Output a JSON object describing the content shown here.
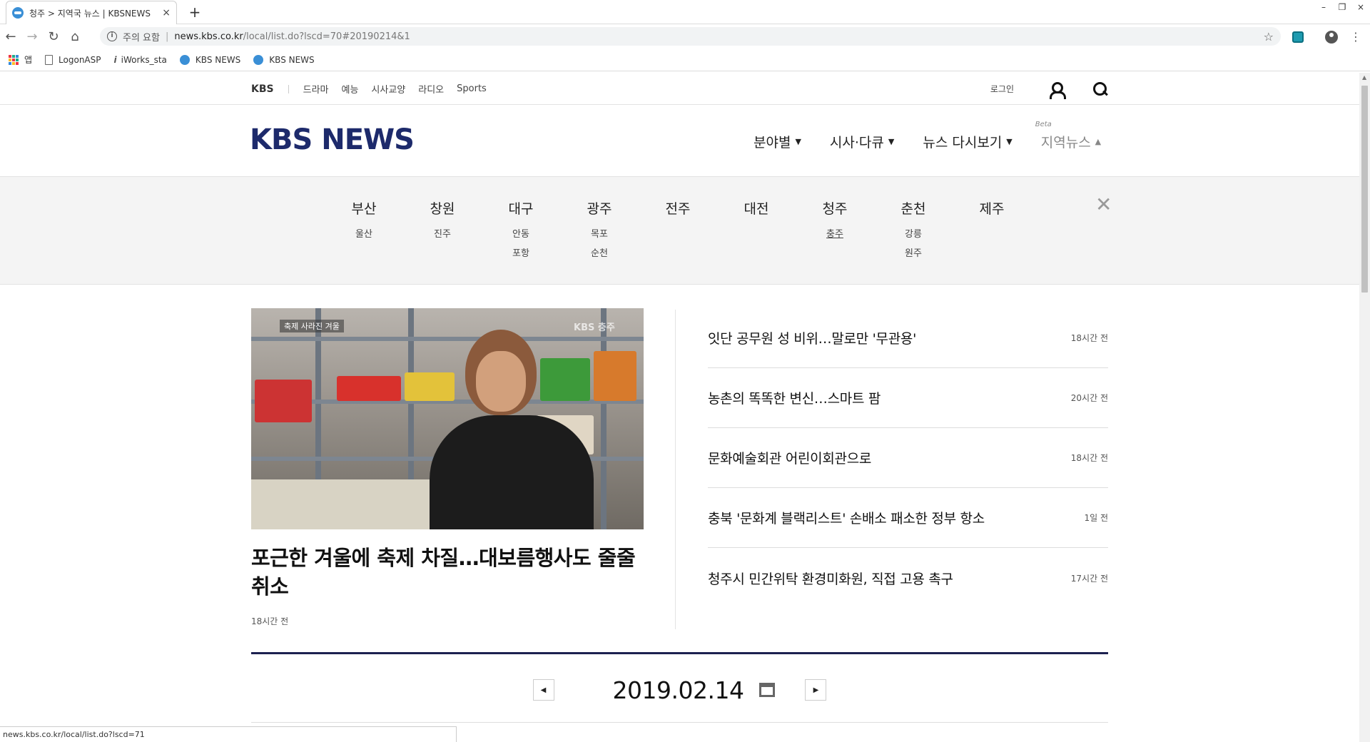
{
  "browser": {
    "tab_title": "청주 > 지역국 뉴스 | KBSNEWS",
    "tab_close": "×",
    "new_tab": "+",
    "window_controls": [
      "–",
      "❐",
      "×"
    ],
    "nav": {
      "back": "←",
      "forward": "→",
      "reload": "↻",
      "home": "⌂"
    },
    "address": {
      "security_label": "주의 요함",
      "url_host": "news.kbs.co.kr",
      "url_path": "/local/list.do?lscd=70#20190214&1"
    },
    "bookmarks": [
      {
        "label": "앱",
        "icon": "apps-icon"
      },
      {
        "label": "LogonASP",
        "icon": "page-icon"
      },
      {
        "label": "iWorks_sta",
        "icon": "iworks-icon"
      },
      {
        "label": "KBS NEWS",
        "icon": "kbs-icon"
      },
      {
        "label": "KBS NEWS",
        "icon": "kbs-icon"
      }
    ],
    "status_url": "news.kbs.co.kr/local/list.do?lscd=71"
  },
  "gnb": {
    "brand": "KBS",
    "links": [
      "드라마",
      "예능",
      "시사교양",
      "라디오",
      "Sports"
    ],
    "login": "로그인"
  },
  "header": {
    "logo": "KBS NEWS",
    "menu": [
      {
        "label": "분야별",
        "caret": "▼"
      },
      {
        "label": "시사·다큐",
        "caret": "▼"
      },
      {
        "label": "뉴스 다시보기",
        "caret": "▼"
      },
      {
        "label": "지역뉴스",
        "caret": "▲",
        "badge": "Beta"
      }
    ]
  },
  "regions": [
    {
      "name": "부산",
      "subs": [
        "울산"
      ]
    },
    {
      "name": "창원",
      "subs": [
        "진주"
      ]
    },
    {
      "name": "대구",
      "subs": [
        "안동",
        "포항"
      ]
    },
    {
      "name": "광주",
      "subs": [
        "목포",
        "순천"
      ]
    },
    {
      "name": "전주",
      "subs": []
    },
    {
      "name": "대전",
      "subs": []
    },
    {
      "name": "청주",
      "subs": [
        "충주"
      ]
    },
    {
      "name": "춘천",
      "subs": [
        "강릉",
        "원주"
      ]
    },
    {
      "name": "제주",
      "subs": []
    }
  ],
  "region_close": "✕",
  "featured": {
    "image_tag": "축제 사라진 겨울",
    "image_watermark": "KBS 충주",
    "headline": "포근한 겨울에 축제 차질…대보름행사도 줄줄 취소",
    "time": "18시간 전"
  },
  "news": [
    {
      "title": "잇단 공무원 성 비위…말로만 '무관용'",
      "time": "18시간 전"
    },
    {
      "title": "농촌의 똑똑한 변신…스마트 팜",
      "time": "20시간 전"
    },
    {
      "title": "문화예술회관 어린이회관으로",
      "time": "18시간 전"
    },
    {
      "title": "충북 '문화계 블랙리스트' 손배소 패소한 정부 항소",
      "time": "1일 전"
    },
    {
      "title": "청주시 민간위탁 환경미화원, 직접 고용 촉구",
      "time": "17시간 전"
    }
  ],
  "date_nav": {
    "date": "2019.02.14",
    "prev": "◀",
    "next": "▶"
  }
}
